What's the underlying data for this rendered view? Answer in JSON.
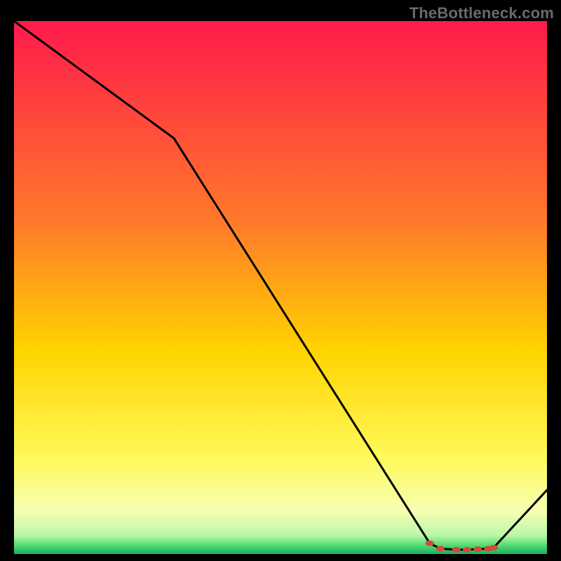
{
  "watermark_text": "TheBottleneck.com",
  "chart_data": {
    "type": "line",
    "title": "",
    "xlabel": "",
    "ylabel": "",
    "xlim": [
      0,
      100
    ],
    "ylim": [
      0,
      100
    ],
    "grid": false,
    "series": [
      {
        "name": "bottleneck-curve",
        "color": "#000000",
        "x": [
          0,
          30,
          78,
          80,
          83,
          85,
          87,
          89,
          90,
          100
        ],
        "values": [
          100,
          78,
          2,
          1,
          0.8,
          0.8,
          0.9,
          1,
          1.2,
          12
        ]
      }
    ],
    "markers": {
      "name": "highlight-region",
      "color": "#d44a3b",
      "x": [
        78,
        80,
        83,
        85,
        87,
        89,
        90
      ],
      "values": [
        2,
        1,
        0.8,
        0.8,
        0.9,
        1,
        1.2
      ]
    },
    "background_gradient": {
      "stops": [
        {
          "offset": 0.0,
          "color": "#ff1a4b"
        },
        {
          "offset": 0.38,
          "color": "#ff7a2a"
        },
        {
          "offset": 0.62,
          "color": "#ffd400"
        },
        {
          "offset": 0.82,
          "color": "#fff95a"
        },
        {
          "offset": 0.92,
          "color": "#f6ffb3"
        },
        {
          "offset": 0.965,
          "color": "#baf7a8"
        },
        {
          "offset": 0.985,
          "color": "#4fd96f"
        },
        {
          "offset": 1.0,
          "color": "#18b060"
        }
      ]
    }
  }
}
